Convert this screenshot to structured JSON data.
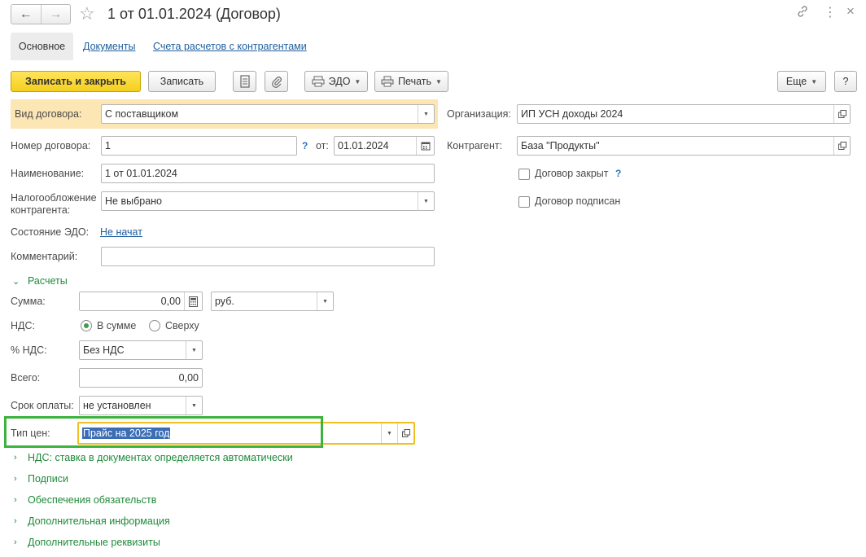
{
  "header": {
    "title": "1 от 01.01.2024 (Договор)",
    "back_icon": "arrow-left-icon",
    "forward_icon": "arrow-right-icon",
    "favorite_icon": "star-icon",
    "link_icon": "link-icon",
    "more_icon": "vertical-dots-icon",
    "close_icon": "close-icon"
  },
  "tabs": [
    {
      "label": "Основное",
      "active": true
    },
    {
      "label": "Документы",
      "active": false
    },
    {
      "label": "Счета расчетов с контрагентами",
      "active": false
    }
  ],
  "toolbar": {
    "save_close": "Записать и закрыть",
    "save": "Записать",
    "edo": "ЭДО",
    "print": "Печать",
    "more": "Еще",
    "help": "?"
  },
  "form": {
    "contract_type": {
      "label": "Вид договора:",
      "value": "С поставщиком"
    },
    "number": {
      "label": "Номер договора:",
      "value": "1",
      "help": "?",
      "date_label": "от:",
      "date_value": "01.01.2024"
    },
    "name": {
      "label": "Наименование:",
      "value": "1 от 01.01.2024"
    },
    "taxation": {
      "label_line1": "Налогообложение",
      "label_line2": "контрагента:",
      "value": "Не выбрано"
    },
    "edo_state": {
      "label": "Состояние ЭДО:",
      "value": "Не начат"
    },
    "comment": {
      "label": "Комментарий:",
      "value": ""
    },
    "organization": {
      "label": "Организация:",
      "value": "ИП УСН доходы 2024"
    },
    "counterparty": {
      "label": "Контрагент:",
      "value": "База \"Продукты\""
    },
    "closed": {
      "label": "Договор закрыт",
      "checked": false,
      "help": "?"
    },
    "signed": {
      "label": "Договор подписан",
      "checked": false
    }
  },
  "settlements": {
    "section_label": "Расчеты",
    "sum": {
      "label": "Сумма:",
      "value": "0,00",
      "currency": "руб."
    },
    "vat": {
      "label": "НДС:",
      "option_in_sum": "В сумме",
      "option_on_top": "Сверху",
      "selected": "В сумме"
    },
    "vat_rate": {
      "label": "% НДС:",
      "value": "Без НДС"
    },
    "total": {
      "label": "Всего:",
      "value": "0,00"
    },
    "payment_term": {
      "label": "Срок оплаты:",
      "value": "не установлен"
    },
    "price_type": {
      "label": "Тип цен:",
      "value": "Прайс на 2025 год"
    }
  },
  "collapsed_sections": [
    "НДС: ставка в документах определяется автоматически",
    "Подписи",
    "Обеспечения обязательств",
    "Дополнительная информация",
    "Дополнительные реквизиты"
  ],
  "colors": {
    "primary_button": "#f5cf1c",
    "highlight_row": "#fbe6b4",
    "link_green": "#1f8a3a",
    "link_blue": "#1f5e9e",
    "annotation_green": "#3cb33c",
    "focus_yellow": "#f0c020",
    "selection": "#3b6db5"
  }
}
